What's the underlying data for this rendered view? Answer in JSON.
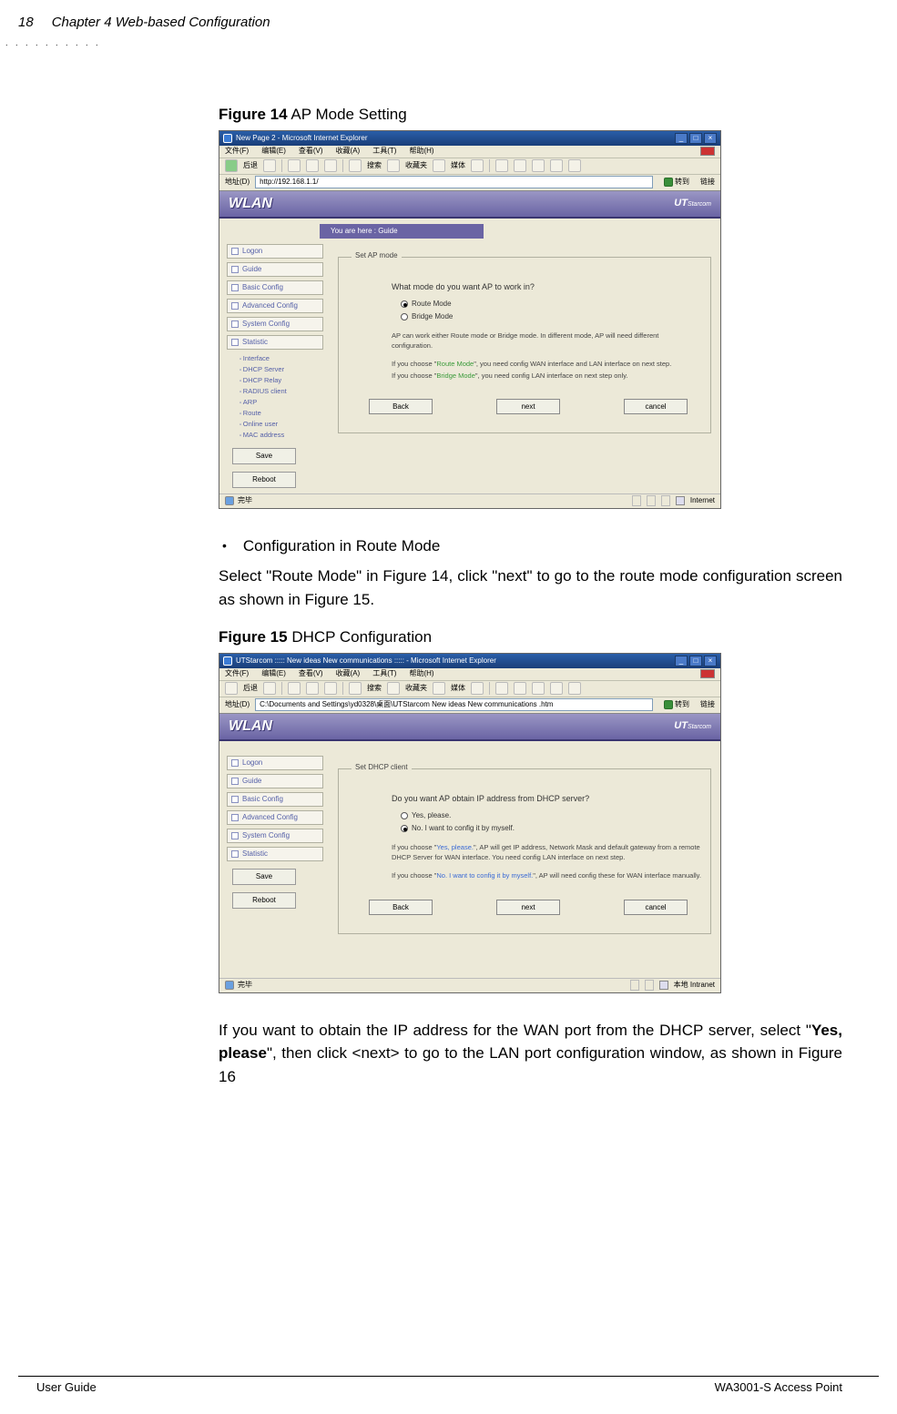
{
  "header": {
    "page_number": "18",
    "chapter": "Chapter 4 Web-based Configuration"
  },
  "figure14": {
    "caption_bold": "Figure 14",
    "caption_rest": " AP Mode Setting",
    "titlebar": "New Page 2 - Microsoft Internet Explorer",
    "menubar": {
      "file": "文件(F)",
      "edit": "编辑(E)",
      "view": "查看(V)",
      "fav": "收藏(A)",
      "tools": "工具(T)",
      "help": "帮助(H)"
    },
    "toolbar": {
      "back": "后退",
      "search": "搜索",
      "fav": "收藏夹",
      "media": "媒体"
    },
    "addr_label": "地址(D)",
    "url": "http://192.168.1.1/",
    "go": "转到",
    "links": "链接",
    "wlan": "WLAN",
    "uts_main": "UT",
    "uts_rest": "Starcom",
    "breadcrumb": "You are here : Guide",
    "sidebar": {
      "items": [
        "Logon",
        "Guide",
        "Basic Config",
        "Advanced Config",
        "System Config",
        "Statistic"
      ],
      "subitems": [
        "Interface",
        "DHCP Server",
        "DHCP Relay",
        "RADIUS client",
        "ARP",
        "Route",
        "Online user",
        "MAC address"
      ],
      "save": "Save",
      "reboot": "Reboot"
    },
    "panel": {
      "legend": "Set AP mode",
      "question": "What mode do you want AP to work in?",
      "opt1": "Route Mode",
      "opt2": "Bridge Mode",
      "info1": "AP can work either Route mode or Bridge mode. In different mode, AP will need different configuration.",
      "info2a": "If you choose \"",
      "info2b": "Route Mode",
      "info2c": "\", you need config WAN interface and LAN interface on next step.",
      "info3a": "If you choose \"",
      "info3b": "Bridge Mode",
      "info3c": "\", you need config LAN interface on next step only.",
      "back": "Back",
      "next": "next",
      "cancel": "cancel"
    },
    "status_left": "完毕",
    "status_right": "Internet"
  },
  "bullet_text": "Configuration in Route Mode",
  "para1": "Select \"Route Mode\" in Figure 14, click \"next\" to go to the route mode configuration screen as shown in Figure 15.",
  "figure15": {
    "caption_bold": "Figure 15",
    "caption_rest": " DHCP Configuration",
    "titlebar": "UTStarcom ::::: New ideas New communications ::::: - Microsoft Internet Explorer",
    "menubar": {
      "file": "文件(F)",
      "edit": "编辑(E)",
      "view": "查看(V)",
      "fav": "收藏(A)",
      "tools": "工具(T)",
      "help": "帮助(H)"
    },
    "toolbar": {
      "back": "后退",
      "search": "搜索",
      "fav": "收藏夹",
      "media": "媒体"
    },
    "addr_label": "地址(D)",
    "url": "C:\\Documents and Settings\\yd0328\\桌面\\UTStarcom    New ideas New communications     .htm",
    "go": "转到",
    "links": "链接",
    "wlan": "WLAN",
    "uts_main": "UT",
    "uts_rest": "Starcom",
    "sidebar": {
      "items": [
        "Logon",
        "Guide",
        "Basic Config",
        "Advanced Config",
        "System Config",
        "Statistic"
      ],
      "save": "Save",
      "reboot": "Reboot"
    },
    "panel": {
      "legend": "Set DHCP client",
      "question": "Do you want AP obtain IP address from DHCP server?",
      "opt1": "Yes, please.",
      "opt2": "No. I want to config it by myself.",
      "info1a": "If you choose \"",
      "info1b": "Yes, please.",
      "info1c": "\", AP will get IP address, Network Mask and default gateway from a remote DHCP Server for WAN interface. You need config LAN interface on next step.",
      "info2a": "If you choose \"",
      "info2b": "No. I want to config it by myself.",
      "info2c": "\", AP will need config these for WAN interface manually.",
      "back": "Back",
      "next": "next",
      "cancel": "cancel"
    },
    "status_left": "完毕",
    "status_right": "本地 Intranet"
  },
  "para2_a": "If you want to obtain the IP address for the WAN port from the DHCP server, select \"",
  "para2_b": "Yes, please",
  "para2_c": "\", then click <next> to go to the LAN port configuration window, as shown in Figure 16",
  "footer": {
    "left": "User Guide",
    "right": "WA3001-S Access Point"
  }
}
